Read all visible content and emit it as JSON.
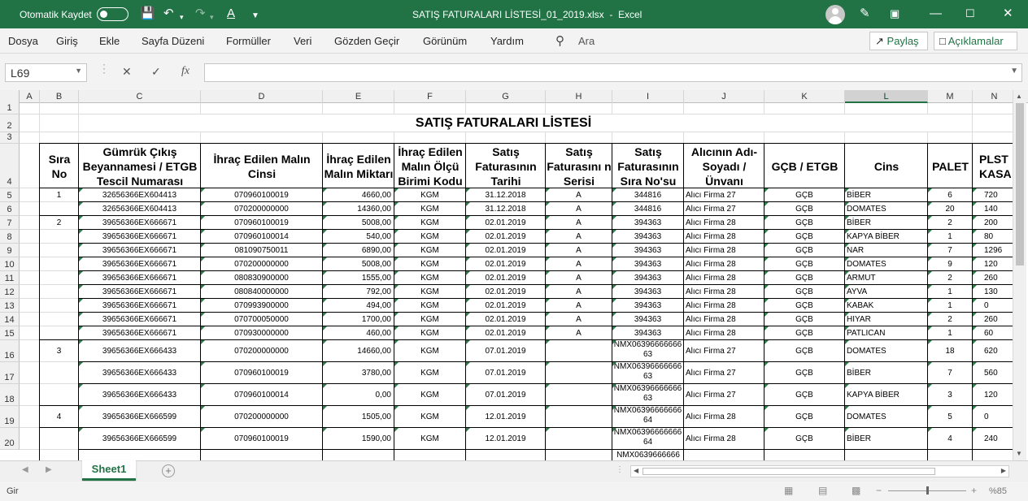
{
  "titlebar": {
    "autosave_label": "Otomatik Kaydet",
    "title": "SATIŞ FATURALARI LİSTESİ_01_2019.xlsx  -  Excel"
  },
  "menu": {
    "items": [
      "Dosya",
      "Giriş",
      "Ekle",
      "Sayfa Düzeni",
      "Formüller",
      "Veri",
      "Gözden Geçir",
      "Görünüm",
      "Yardım"
    ],
    "search": "Ara",
    "share": "Paylaş",
    "comments": "Açıklamalar"
  },
  "formula": {
    "namebox": "L69",
    "cancel": "✕",
    "enter": "✓",
    "fx": "fx",
    "value": ""
  },
  "columns": [
    "A",
    "B",
    "C",
    "D",
    "E",
    "F",
    "G",
    "H",
    "I",
    "J",
    "K",
    "L",
    "M",
    "N"
  ],
  "selected_column": "L",
  "rows": [
    "1",
    "2",
    "3",
    "4",
    "5",
    "6",
    "7",
    "8",
    "9",
    "10",
    "11",
    "12",
    "13",
    "14",
    "15",
    "16",
    "17",
    "18",
    "19",
    "20"
  ],
  "sheet_title": "SATIŞ FATURALARI LİSTESİ",
  "headers": [
    "Sıra No",
    "Gümrük Çıkış Beyannamesi / ETGB Tescil Numarası",
    "İhraç Edilen Malın Cinsi",
    "İhraç Edilen Malın Miktarı",
    "İhraç Edilen Malın Ölçü Birimi Kodu",
    "Satış Faturasının Tarihi",
    "Satış Faturasını n Serisi",
    "Satış Faturasının Sıra No'su",
    "Alıcının Adı-Soyadı / Ünvanı",
    "GÇB / ETGB",
    "Cins",
    "PALET",
    "PLST KASA"
  ],
  "data": [
    [
      "1",
      "32656366EX604413",
      "070960100019",
      "4660,00",
      "KGM",
      "31.12.2018",
      "A",
      "344816",
      "Alıcı Firma 27",
      "GÇB",
      "BİBER",
      "6",
      "720"
    ],
    [
      "",
      "32656366EX604413",
      "070200000000",
      "14360,00",
      "KGM",
      "31.12.2018",
      "A",
      "344816",
      "Alıcı Firma 27",
      "GÇB",
      "DOMATES",
      "20",
      "140"
    ],
    [
      "2",
      "39656366EX666671",
      "070960100019",
      "5008,00",
      "KGM",
      "02.01.2019",
      "A",
      "394363",
      "Alıcı Firma 28",
      "GÇB",
      "BİBER",
      "2",
      "200"
    ],
    [
      "",
      "39656366EX666671",
      "070960100014",
      "540,00",
      "KGM",
      "02.01.2019",
      "A",
      "394363",
      "Alıcı Firma 28",
      "GÇB",
      "KAPYA BİBER",
      "1",
      "80"
    ],
    [
      "",
      "39656366EX666671",
      "081090750011",
      "6890,00",
      "KGM",
      "02.01.2019",
      "A",
      "394363",
      "Alıcı Firma 28",
      "GÇB",
      "NAR",
      "7",
      "1296"
    ],
    [
      "",
      "39656366EX666671",
      "070200000000",
      "5008,00",
      "KGM",
      "02.01.2019",
      "A",
      "394363",
      "Alıcı Firma 28",
      "GÇB",
      "DOMATES",
      "9",
      "120"
    ],
    [
      "",
      "39656366EX666671",
      "080830900000",
      "1555,00",
      "KGM",
      "02.01.2019",
      "A",
      "394363",
      "Alıcı Firma 28",
      "GÇB",
      "ARMUT",
      "2",
      "260"
    ],
    [
      "",
      "39656366EX666671",
      "080840000000",
      "792,00",
      "KGM",
      "02.01.2019",
      "A",
      "394363",
      "Alıcı Firma 28",
      "GÇB",
      "AYVA",
      "1",
      "130"
    ],
    [
      "",
      "39656366EX666671",
      "070993900000",
      "494,00",
      "KGM",
      "02.01.2019",
      "A",
      "394363",
      "Alıcı Firma 28",
      "GÇB",
      "KABAK",
      "1",
      "0"
    ],
    [
      "",
      "39656366EX666671",
      "070700050000",
      "1700,00",
      "KGM",
      "02.01.2019",
      "A",
      "394363",
      "Alıcı Firma 28",
      "GÇB",
      "HIYAR",
      "2",
      "260"
    ],
    [
      "",
      "39656366EX666671",
      "070930000000",
      "460,00",
      "KGM",
      "02.01.2019",
      "A",
      "394363",
      "Alıcı Firma 28",
      "GÇB",
      "PATLICAN",
      "1",
      "60"
    ],
    [
      "3",
      "39656366EX666433",
      "070200000000",
      "14660,00",
      "KGM",
      "07.01.2019",
      "",
      "NMX0639666666663",
      "Alıcı Firma 27",
      "GÇB",
      "DOMATES",
      "18",
      "620"
    ],
    [
      "",
      "39656366EX666433",
      "070960100019",
      "3780,00",
      "KGM",
      "07.01.2019",
      "",
      "NMX0639666666663",
      "Alıcı Firma 27",
      "GÇB",
      "BİBER",
      "7",
      "560"
    ],
    [
      "",
      "39656366EX666433",
      "070960100014",
      "0,00",
      "KGM",
      "07.01.2019",
      "",
      "NMX0639666666663",
      "Alıcı Firma 27",
      "GÇB",
      "KAPYA BİBER",
      "3",
      "120"
    ],
    [
      "4",
      "39656366EX666599",
      "070200000000",
      "1505,00",
      "KGM",
      "12.01.2019",
      "",
      "NMX0639666666664",
      "Alıcı Firma 28",
      "GÇB",
      "DOMATES",
      "5",
      "0"
    ],
    [
      "",
      "39656366EX666599",
      "070960100019",
      "1590,00",
      "KGM",
      "12.01.2019",
      "",
      "NMX0639666666664",
      "Alıcı Firma 28",
      "GÇB",
      "BİBER",
      "4",
      "240"
    ]
  ],
  "partial_row_text": "NMX0639666666",
  "sheet_tab": "Sheet1",
  "status": {
    "mode": "Gir",
    "zoom": "%85"
  },
  "colors": {
    "accent": "#217346"
  }
}
